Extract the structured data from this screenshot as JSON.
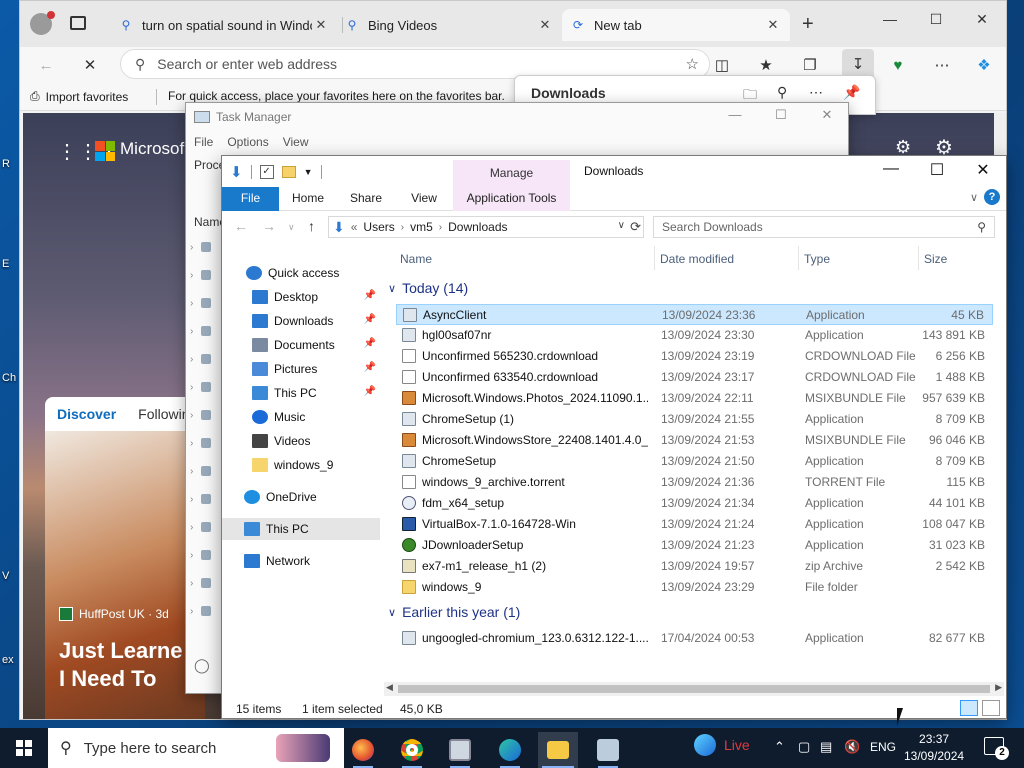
{
  "desktop": {
    "fragments": [
      "R",
      "E",
      "Ch",
      "V",
      "ex"
    ]
  },
  "edge": {
    "tabs": [
      {
        "label": "turn on spatial sound in Windo",
        "icon": "search-icon"
      },
      {
        "label": "Bing Videos",
        "icon": "search-icon"
      },
      {
        "label": "New tab",
        "icon": "loading-icon"
      }
    ],
    "address_placeholder": "Search or enter web address",
    "favbar_import": "Import favorites",
    "favbar_hint": "For quick access, place your favorites here on the favorites bar.",
    "downloads_panel_title": "Downloads",
    "page": {
      "brand": "Microsof",
      "discover": "Discover",
      "following": "Followin",
      "news_source": "HuffPost UK · 3d",
      "headline_line1": "Just Learne",
      "headline_line2": "I Need To"
    }
  },
  "taskmanager": {
    "title": "Task Manager",
    "menu": [
      "File",
      "Options",
      "View"
    ],
    "tab": "Proce",
    "column": "Name"
  },
  "explorer": {
    "title": "Downloads",
    "manage_tab": "Manage",
    "ribbon_tabs": [
      "File",
      "Home",
      "Share",
      "View",
      "Application Tools"
    ],
    "breadcrumb": [
      "Users",
      "vm5",
      "Downloads"
    ],
    "search_placeholder": "Search Downloads",
    "nav": [
      {
        "label": "Quick access",
        "icon": "star-icon",
        "pinned": false
      },
      {
        "label": "Desktop",
        "icon": "desktop-icon",
        "pinned": true
      },
      {
        "label": "Downloads",
        "icon": "download-arrow-icon",
        "pinned": true
      },
      {
        "label": "Documents",
        "icon": "documents-icon",
        "pinned": true
      },
      {
        "label": "Pictures",
        "icon": "pictures-icon",
        "pinned": true
      },
      {
        "label": "This PC",
        "icon": "pc-icon",
        "pinned": true
      },
      {
        "label": "Music",
        "icon": "music-icon",
        "pinned": false
      },
      {
        "label": "Videos",
        "icon": "videos-icon",
        "pinned": false
      },
      {
        "label": "windows_9",
        "icon": "folder-icon",
        "pinned": false
      },
      {
        "label": "OneDrive",
        "icon": "cloud-icon",
        "pinned": false
      },
      {
        "label": "This PC",
        "icon": "pc-icon",
        "pinned": false
      },
      {
        "label": "Network",
        "icon": "network-icon",
        "pinned": false
      }
    ],
    "columns": {
      "name": "Name",
      "date": "Date modified",
      "type": "Type",
      "size": "Size"
    },
    "groups": [
      {
        "label": "Today (14)",
        "files": [
          {
            "name": "AsyncClient",
            "date": "13/09/2024 23:36",
            "type": "Application",
            "size": "45 KB",
            "icon": "app",
            "selected": true
          },
          {
            "name": "hgl00saf07nr",
            "date": "13/09/2024 23:30",
            "type": "Application",
            "size": "143 891 KB",
            "icon": "app",
            "selected": false
          },
          {
            "name": "Unconfirmed 565230.crdownload",
            "date": "13/09/2024 23:19",
            "type": "CRDOWNLOAD File",
            "size": "6 256 KB",
            "icon": "doc",
            "selected": false
          },
          {
            "name": "Unconfirmed 633540.crdownload",
            "date": "13/09/2024 23:17",
            "type": "CRDOWNLOAD File",
            "size": "1 488 KB",
            "icon": "doc",
            "selected": false
          },
          {
            "name": "Microsoft.Windows.Photos_2024.11090.1...",
            "date": "13/09/2024 22:11",
            "type": "MSIXBUNDLE File",
            "size": "957 639 KB",
            "icon": "box",
            "selected": false
          },
          {
            "name": "ChromeSetup (1)",
            "date": "13/09/2024 21:55",
            "type": "Application",
            "size": "8 709 KB",
            "icon": "app",
            "selected": false
          },
          {
            "name": "Microsoft.WindowsStore_22408.1401.4.0_...",
            "date": "13/09/2024 21:53",
            "type": "MSIXBUNDLE File",
            "size": "96 046 KB",
            "icon": "box",
            "selected": false
          },
          {
            "name": "ChromeSetup",
            "date": "13/09/2024 21:50",
            "type": "Application",
            "size": "8 709 KB",
            "icon": "app",
            "selected": false
          },
          {
            "name": "windows_9_archive.torrent",
            "date": "13/09/2024 21:36",
            "type": "TORRENT File",
            "size": "115 KB",
            "icon": "doc",
            "selected": false
          },
          {
            "name": "fdm_x64_setup",
            "date": "13/09/2024 21:34",
            "type": "Application",
            "size": "44 101 KB",
            "icon": "cd",
            "selected": false
          },
          {
            "name": "VirtualBox-7.1.0-164728-Win",
            "date": "13/09/2024 21:24",
            "type": "Application",
            "size": "108 047 KB",
            "icon": "vb",
            "selected": false
          },
          {
            "name": "JDownloaderSetup",
            "date": "13/09/2024 21:23",
            "type": "Application",
            "size": "31 023 KB",
            "icon": "jd",
            "selected": false
          },
          {
            "name": "ex7-m1_release_h1 (2)",
            "date": "13/09/2024 19:57",
            "type": "zip Archive",
            "size": "2 542 KB",
            "icon": "zip",
            "selected": false
          },
          {
            "name": "windows_9",
            "date": "13/09/2024 23:29",
            "type": "File folder",
            "size": "",
            "icon": "fold",
            "selected": false
          }
        ]
      },
      {
        "label": "Earlier this year (1)",
        "files": [
          {
            "name": "ungoogled-chromium_123.0.6312.122-1....",
            "date": "17/04/2024 00:53",
            "type": "Application",
            "size": "82 677 KB",
            "icon": "app",
            "selected": false
          }
        ]
      }
    ],
    "status": {
      "count": "15 items",
      "selected": "1 item selected",
      "size": "45,0 KB"
    }
  },
  "taskbar": {
    "search_placeholder": "Type here to search",
    "live_label": "Live",
    "language": "ENG",
    "time": "23:37",
    "date": "13/09/2024",
    "notifications": "2"
  }
}
